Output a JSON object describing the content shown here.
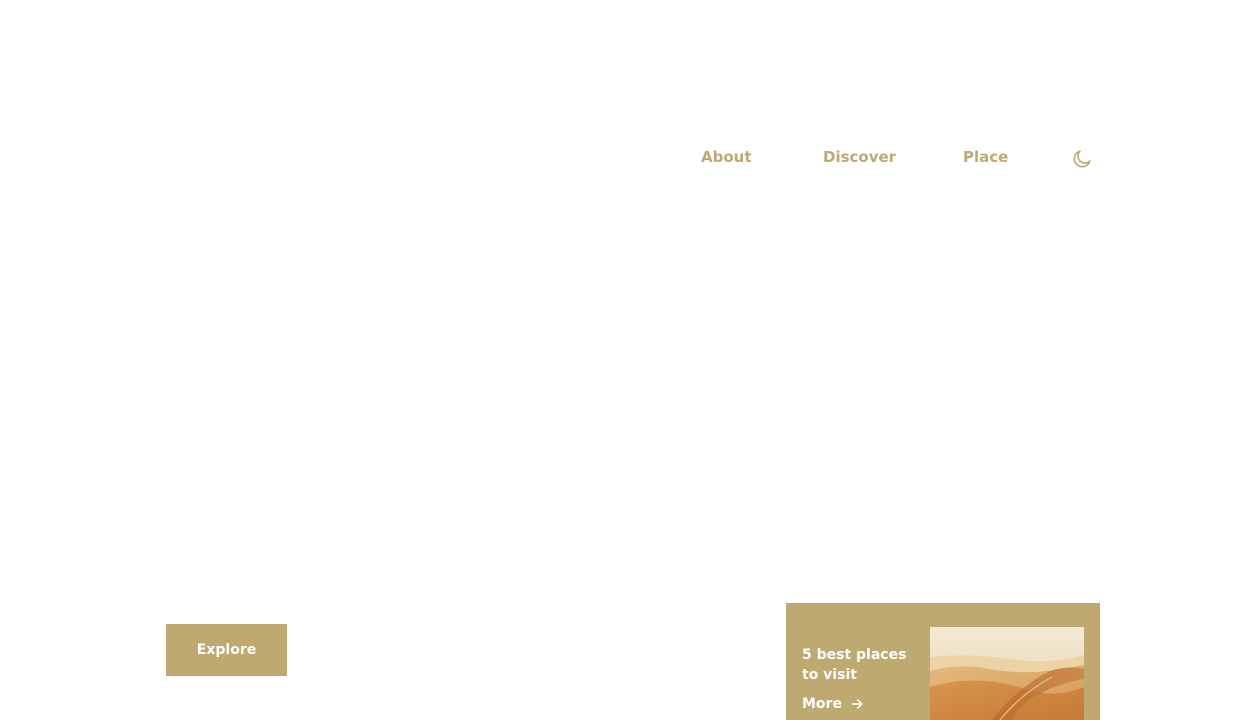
{
  "nav": {
    "links": [
      {
        "label": "About"
      },
      {
        "label": "Discover"
      },
      {
        "label": "Place"
      }
    ],
    "theme_toggle_icon": "moon-icon"
  },
  "hero": {
    "explore_label": "Explore"
  },
  "promo": {
    "title": "5 best places to visit",
    "more_label": "More",
    "more_icon": "arrow-right-icon",
    "image": "desert-dunes-image"
  },
  "colors": {
    "accent": "#bea971",
    "background": "#ffffff",
    "card_text": "#ffffff"
  }
}
